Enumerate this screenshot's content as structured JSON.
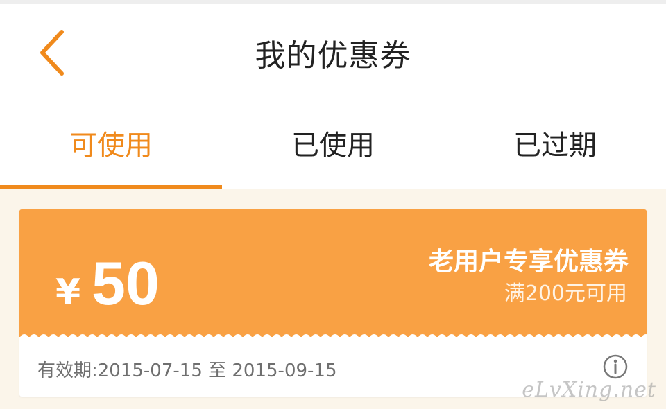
{
  "header": {
    "title": "我的优惠券",
    "back_icon": "chevron-left-icon",
    "accent_color": "#f08a1c"
  },
  "tabs": [
    {
      "label": "可使用",
      "active": true
    },
    {
      "label": "已使用",
      "active": false
    },
    {
      "label": "已过期",
      "active": false
    }
  ],
  "coupon": {
    "currency": "¥",
    "amount": "50",
    "name": "老用户专享优惠券",
    "condition": "满200元可用",
    "validity": "有效期:2015-07-15 至 2015-09-15",
    "info_icon": "info-icon",
    "color": "#f9a144"
  },
  "watermark": "eLvXing.net"
}
